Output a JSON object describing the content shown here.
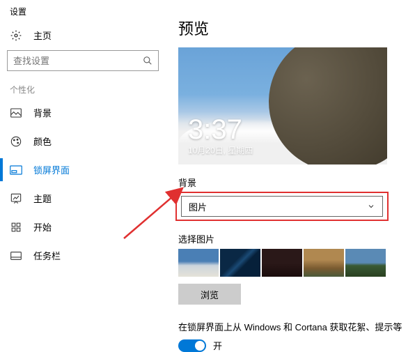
{
  "app_title": "设置",
  "home_label": "主页",
  "search_placeholder": "查找设置",
  "section_label": "个性化",
  "nav": {
    "background": "背景",
    "colors": "颜色",
    "lockscreen": "锁屏界面",
    "themes": "主题",
    "start": "开始",
    "taskbar": "任务栏"
  },
  "main": {
    "preview_title": "预览",
    "time": "3:37",
    "date": "10月20日, 星期四",
    "bg_label": "背景",
    "bg_value": "图片",
    "choose_label": "选择图片",
    "browse": "浏览",
    "toggle_label": "在锁屏界面上从 Windows 和 Cortana 获取花絮、提示等",
    "toggle_state": "开"
  }
}
